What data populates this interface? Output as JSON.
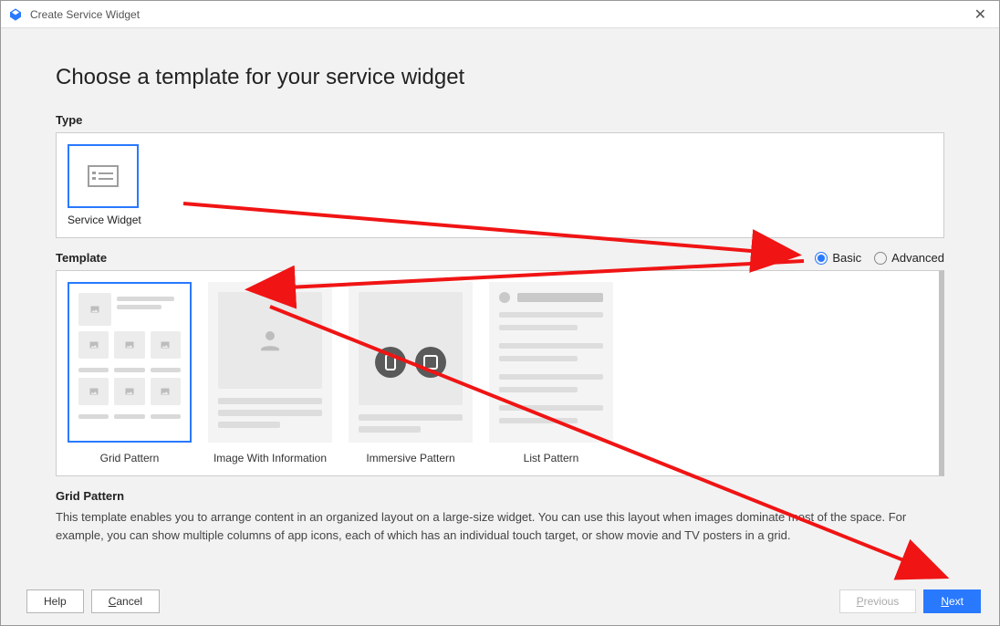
{
  "window": {
    "title": "Create Service Widget"
  },
  "heading": "Choose a template for your service widget",
  "type_section": {
    "label": "Type",
    "item_label": "Service Widget"
  },
  "template_section": {
    "label": "Template",
    "radios": {
      "basic": "Basic",
      "advanced": "Advanced",
      "selected": "basic"
    },
    "items": {
      "grid": "Grid Pattern",
      "image_info": "Image With Information",
      "immersive": "Immersive Pattern",
      "list": "List Pattern"
    },
    "selected": "grid"
  },
  "description": {
    "title": "Grid Pattern",
    "body": "This template enables you to arrange content in an organized layout on a large-size widget. You can use this layout when images dominate most of the space. For example, you can show multiple columns of app icons, each of which has an individual touch target, or show movie and TV posters in a grid."
  },
  "footer": {
    "help": "Help",
    "cancel": "Cancel",
    "previous": "Previous",
    "next": "Next"
  }
}
